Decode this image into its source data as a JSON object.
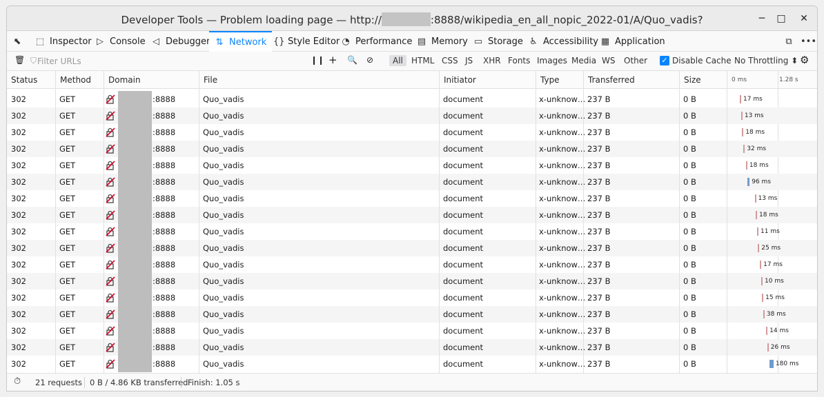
{
  "window": {
    "title_prefix": "Developer Tools — Problem loading page — http://",
    "title_suffix": ":8888/wikipedia_en_all_nopic_2022-01/A/Quo_vadis?",
    "minimize": "─",
    "maximize": "□",
    "close": "✕"
  },
  "tabs": [
    {
      "label": "Inspector",
      "icon": "inspector-icon",
      "glyph": "⬚"
    },
    {
      "label": "Console",
      "icon": "console-icon",
      "glyph": "▷"
    },
    {
      "label": "Debugger",
      "icon": "debugger-icon",
      "glyph": "◁"
    },
    {
      "label": "Network",
      "icon": "network-icon",
      "glyph": "⇅"
    },
    {
      "label": "Style Editor",
      "icon": "style-editor-icon",
      "glyph": "{}"
    },
    {
      "label": "Performance",
      "icon": "performance-icon",
      "glyph": "◔"
    },
    {
      "label": "Memory",
      "icon": "memory-icon",
      "glyph": "▤"
    },
    {
      "label": "Storage",
      "icon": "storage-icon",
      "glyph": "▭"
    },
    {
      "label": "Accessibility",
      "icon": "accessibility-icon",
      "glyph": "♿"
    },
    {
      "label": "Application",
      "icon": "application-icon",
      "glyph": "▦"
    }
  ],
  "filter": {
    "placeholder": "Filter URLs",
    "types": [
      "All",
      "HTML",
      "CSS",
      "JS",
      "XHR",
      "Fonts",
      "Images",
      "Media",
      "WS",
      "Other"
    ],
    "disable_cache": "Disable Cache",
    "throttling": "No Throttling ⬍"
  },
  "columns": [
    "Status",
    "Method",
    "Domain",
    "File",
    "Initiator",
    "Type",
    "Transferred",
    "Size"
  ],
  "waterfall_labels": [
    "0 ms",
    "1.28 s"
  ],
  "requests": [
    {
      "status": "302",
      "method": "GET",
      "domain": ":8888",
      "file": "Quo_vadis",
      "initiator": "document",
      "type": "x-unknow…",
      "transferred": "237 B",
      "size": "0 B",
      "time": "17 ms",
      "start": 0.0,
      "dur": 0.013
    },
    {
      "status": "302",
      "method": "GET",
      "domain": ":8888",
      "file": "Quo_vadis",
      "initiator": "document",
      "type": "x-unknow…",
      "transferred": "237 B",
      "size": "0 B",
      "time": "13 ms",
      "start": 0.013,
      "dur": 0.01
    },
    {
      "status": "302",
      "method": "GET",
      "domain": ":8888",
      "file": "Quo_vadis",
      "initiator": "document",
      "type": "x-unknow…",
      "transferred": "237 B",
      "size": "0 B",
      "time": "18 ms",
      "start": 0.023,
      "dur": 0.014
    },
    {
      "status": "302",
      "method": "GET",
      "domain": ":8888",
      "file": "Quo_vadis",
      "initiator": "document",
      "type": "x-unknow…",
      "transferred": "237 B",
      "size": "0 B",
      "time": "32 ms",
      "start": 0.037,
      "dur": 0.025
    },
    {
      "status": "302",
      "method": "GET",
      "domain": ":8888",
      "file": "Quo_vadis",
      "initiator": "document",
      "type": "x-unknow…",
      "transferred": "237 B",
      "size": "0 B",
      "time": "18 ms",
      "start": 0.062,
      "dur": 0.014
    },
    {
      "status": "302",
      "method": "GET",
      "domain": ":8888",
      "file": "Quo_vadis",
      "initiator": "document",
      "type": "x-unknow…",
      "transferred": "237 B",
      "size": "0 B",
      "time": "96 ms",
      "start": 0.076,
      "dur": 0.075
    },
    {
      "status": "302",
      "method": "GET",
      "domain": ":8888",
      "file": "Quo_vadis",
      "initiator": "document",
      "type": "x-unknow…",
      "transferred": "237 B",
      "size": "0 B",
      "time": "13 ms",
      "start": 0.151,
      "dur": 0.01
    },
    {
      "status": "302",
      "method": "GET",
      "domain": ":8888",
      "file": "Quo_vadis",
      "initiator": "document",
      "type": "x-unknow…",
      "transferred": "237 B",
      "size": "0 B",
      "time": "18 ms",
      "start": 0.161,
      "dur": 0.014
    },
    {
      "status": "302",
      "method": "GET",
      "domain": ":8888",
      "file": "Quo_vadis",
      "initiator": "document",
      "type": "x-unknow…",
      "transferred": "237 B",
      "size": "0 B",
      "time": "11 ms",
      "start": 0.175,
      "dur": 0.009
    },
    {
      "status": "302",
      "method": "GET",
      "domain": ":8888",
      "file": "Quo_vadis",
      "initiator": "document",
      "type": "x-unknow…",
      "transferred": "237 B",
      "size": "0 B",
      "time": "25 ms",
      "start": 0.184,
      "dur": 0.02
    },
    {
      "status": "302",
      "method": "GET",
      "domain": ":8888",
      "file": "Quo_vadis",
      "initiator": "document",
      "type": "x-unknow…",
      "transferred": "237 B",
      "size": "0 B",
      "time": "17 ms",
      "start": 0.204,
      "dur": 0.013
    },
    {
      "status": "302",
      "method": "GET",
      "domain": ":8888",
      "file": "Quo_vadis",
      "initiator": "document",
      "type": "x-unknow…",
      "transferred": "237 B",
      "size": "0 B",
      "time": "10 ms",
      "start": 0.217,
      "dur": 0.008
    },
    {
      "status": "302",
      "method": "GET",
      "domain": ":8888",
      "file": "Quo_vadis",
      "initiator": "document",
      "type": "x-unknow…",
      "transferred": "237 B",
      "size": "0 B",
      "time": "15 ms",
      "start": 0.225,
      "dur": 0.012
    },
    {
      "status": "302",
      "method": "GET",
      "domain": ":8888",
      "file": "Quo_vadis",
      "initiator": "document",
      "type": "x-unknow…",
      "transferred": "237 B",
      "size": "0 B",
      "time": "38 ms",
      "start": 0.237,
      "dur": 0.03
    },
    {
      "status": "302",
      "method": "GET",
      "domain": ":8888",
      "file": "Quo_vadis",
      "initiator": "document",
      "type": "x-unknow…",
      "transferred": "237 B",
      "size": "0 B",
      "time": "14 ms",
      "start": 0.267,
      "dur": 0.011
    },
    {
      "status": "302",
      "method": "GET",
      "domain": ":8888",
      "file": "Quo_vadis",
      "initiator": "document",
      "type": "x-unknow…",
      "transferred": "237 B",
      "size": "0 B",
      "time": "26 ms",
      "start": 0.278,
      "dur": 0.02
    },
    {
      "status": "302",
      "method": "GET",
      "domain": ":8888",
      "file": "Quo_vadis",
      "initiator": "document",
      "type": "x-unknow…",
      "transferred": "237 B",
      "size": "0 B",
      "time": "180 ms",
      "start": 0.298,
      "dur": 0.14
    }
  ],
  "statusbar": {
    "requests": "21 requests",
    "transferred": "0 B / 4.86 KB transferred",
    "finish": "Finish: 1.05 s"
  },
  "colors": {
    "accent": "#0a84ff",
    "bar_short": "#d29a9a",
    "bar_long": "#6f9ccf"
  }
}
